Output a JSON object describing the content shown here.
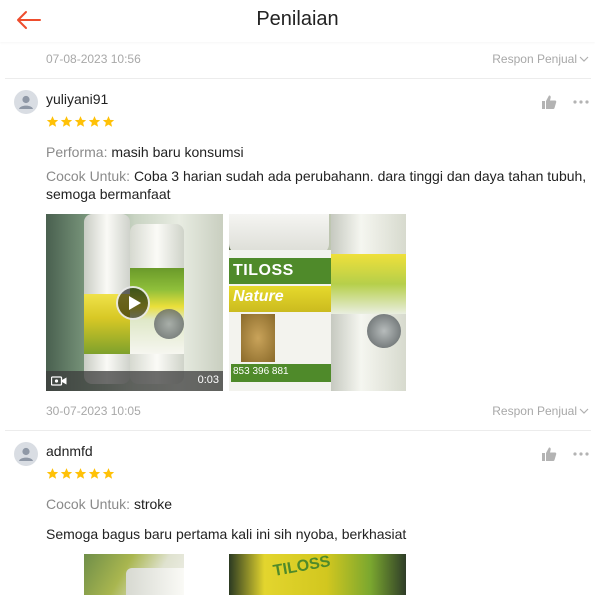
{
  "header": {
    "title": "Penilaian"
  },
  "top_meta": {
    "date": "07-08-2023 10:56",
    "respon": "Respon Penjual"
  },
  "reviews": [
    {
      "username": "yuliyani91",
      "rating": 5,
      "performa_label": "Performa:",
      "performa_value": "masih baru konsumsi",
      "cocok_label": "Cocok Untuk:",
      "cocok_value_line1": "Coba 3 harian sudah ada perubahann. dara tinggi dan daya tahan tubuh,",
      "cocok_value_line2": "semoga bermanfaat",
      "video_duration": "0:03",
      "label_text_1": "TILOSS",
      "label_text_2": "Nature",
      "phone_text": "853 396 881",
      "date": "30-07-2023 10:05",
      "respon": "Respon Penjual"
    },
    {
      "username": "adnmfd",
      "rating": 5,
      "cocok_label": "Cocok Untuk:",
      "cocok_value": "stroke",
      "text": "Semoga bagus baru pertama kali ini sih nyoba, berkhasiat"
    }
  ],
  "colors": {
    "accent": "#ee4d2d",
    "star": "#ffc107",
    "muted": "#a8a8a8",
    "label_green": "#6a9a2a",
    "label_yellow": "#d9c92a"
  },
  "icons": [
    "back-arrow-icon",
    "user-avatar-icon",
    "star-icon",
    "thumbs-up-icon",
    "more-dots-icon",
    "chevron-down-icon",
    "play-icon",
    "video-camera-icon"
  ]
}
